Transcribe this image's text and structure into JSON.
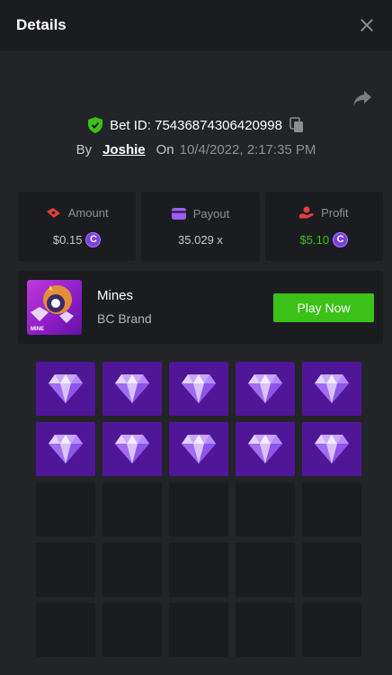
{
  "header": {
    "title": "Details"
  },
  "bet": {
    "id_text": "Bet ID: 75436874306420998",
    "by_label": "By",
    "user": "Joshie",
    "on_label": "On",
    "date": "10/4/2022, 2:17:35 PM"
  },
  "stats": {
    "amount": {
      "label": "Amount",
      "value": "$0.15"
    },
    "payout": {
      "label": "Payout",
      "value": "35.029 x"
    },
    "profit": {
      "label": "Profit",
      "value": "$5.10"
    }
  },
  "coin_symbol": "C",
  "game": {
    "name": "Mines",
    "brand": "BC Brand",
    "thumb_label": "MINE",
    "play_label": "Play Now"
  },
  "colors": {
    "play_button": "#3bc117",
    "profit_value": "#3bc117",
    "gem_tile": "#4f1797",
    "empty_tile": "#1b1c20",
    "coin": "#7b3fe4"
  },
  "board": {
    "rows": 5,
    "cols": 5,
    "tiles": [
      "gem",
      "gem",
      "gem",
      "gem",
      "gem",
      "gem",
      "gem",
      "gem",
      "gem",
      "gem",
      "hidden",
      "hidden",
      "hidden",
      "hidden",
      "hidden",
      "hidden",
      "hidden",
      "hidden",
      "hidden",
      "hidden",
      "hidden",
      "hidden",
      "hidden",
      "hidden",
      "hidden"
    ]
  }
}
